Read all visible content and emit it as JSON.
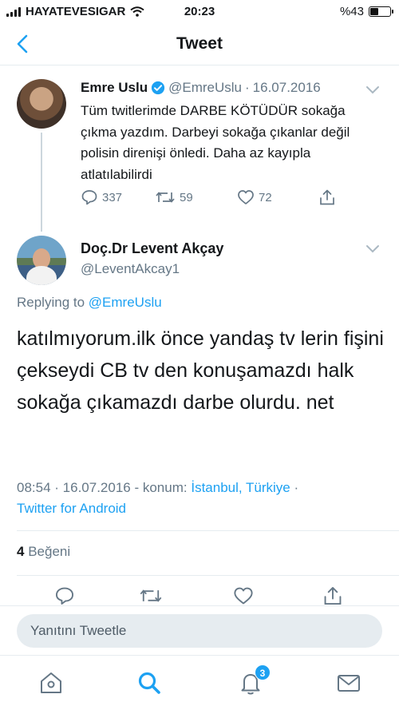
{
  "status_bar": {
    "carrier": "HAYATEVESIGAR",
    "time": "20:23",
    "battery": "%43",
    "battery_level": 0.43
  },
  "nav": {
    "title": "Tweet"
  },
  "parent_tweet": {
    "name": "Emre Uslu",
    "handle": "@EmreUslu",
    "separator": "·",
    "date": "16.07.2016",
    "text": "Tüm twitlerimde DARBE KÖTÜDÜR sokağa çıkma yazdım. Darbeyi sokağa çıkanlar değil polisin direnişi önledi. Daha az kayıpla atlatılabilirdi",
    "replies": "337",
    "retweets": "59",
    "likes": "72"
  },
  "main_tweet": {
    "name": "Doç.Dr Levent Akçay",
    "handle": "@LeventAkcay1",
    "replying_label": "Replying to",
    "replying_handle": "@EmreUslu",
    "text": "katılmıyorum.ilk önce yandaş tv lerin fişini çekseydi CB tv den konuşamazdı halk sokağa çıkamazdı darbe olurdu. net",
    "time": "08:54",
    "sep": " · ",
    "date": "16.07.2016",
    "location_prefix": " - konum: ",
    "location": "İstanbul, Türkiye",
    "sep2": " ·",
    "source": "Twitter for Android",
    "likes_count": "4",
    "likes_label": "Beğeni"
  },
  "reply_bar": {
    "placeholder": "Yanıtını Tweetle"
  },
  "tabs": {
    "notifications_badge": "3"
  },
  "colors": {
    "accent": "#1da1f2",
    "muted": "#657786",
    "text": "#14171a",
    "divider": "#e6ecf0"
  },
  "icons": [
    "back-chevron-icon",
    "verified-badge-icon",
    "chevron-down-icon",
    "reply-icon",
    "retweet-icon",
    "like-icon",
    "share-icon",
    "home-icon",
    "search-icon",
    "notifications-icon",
    "messages-icon"
  ]
}
